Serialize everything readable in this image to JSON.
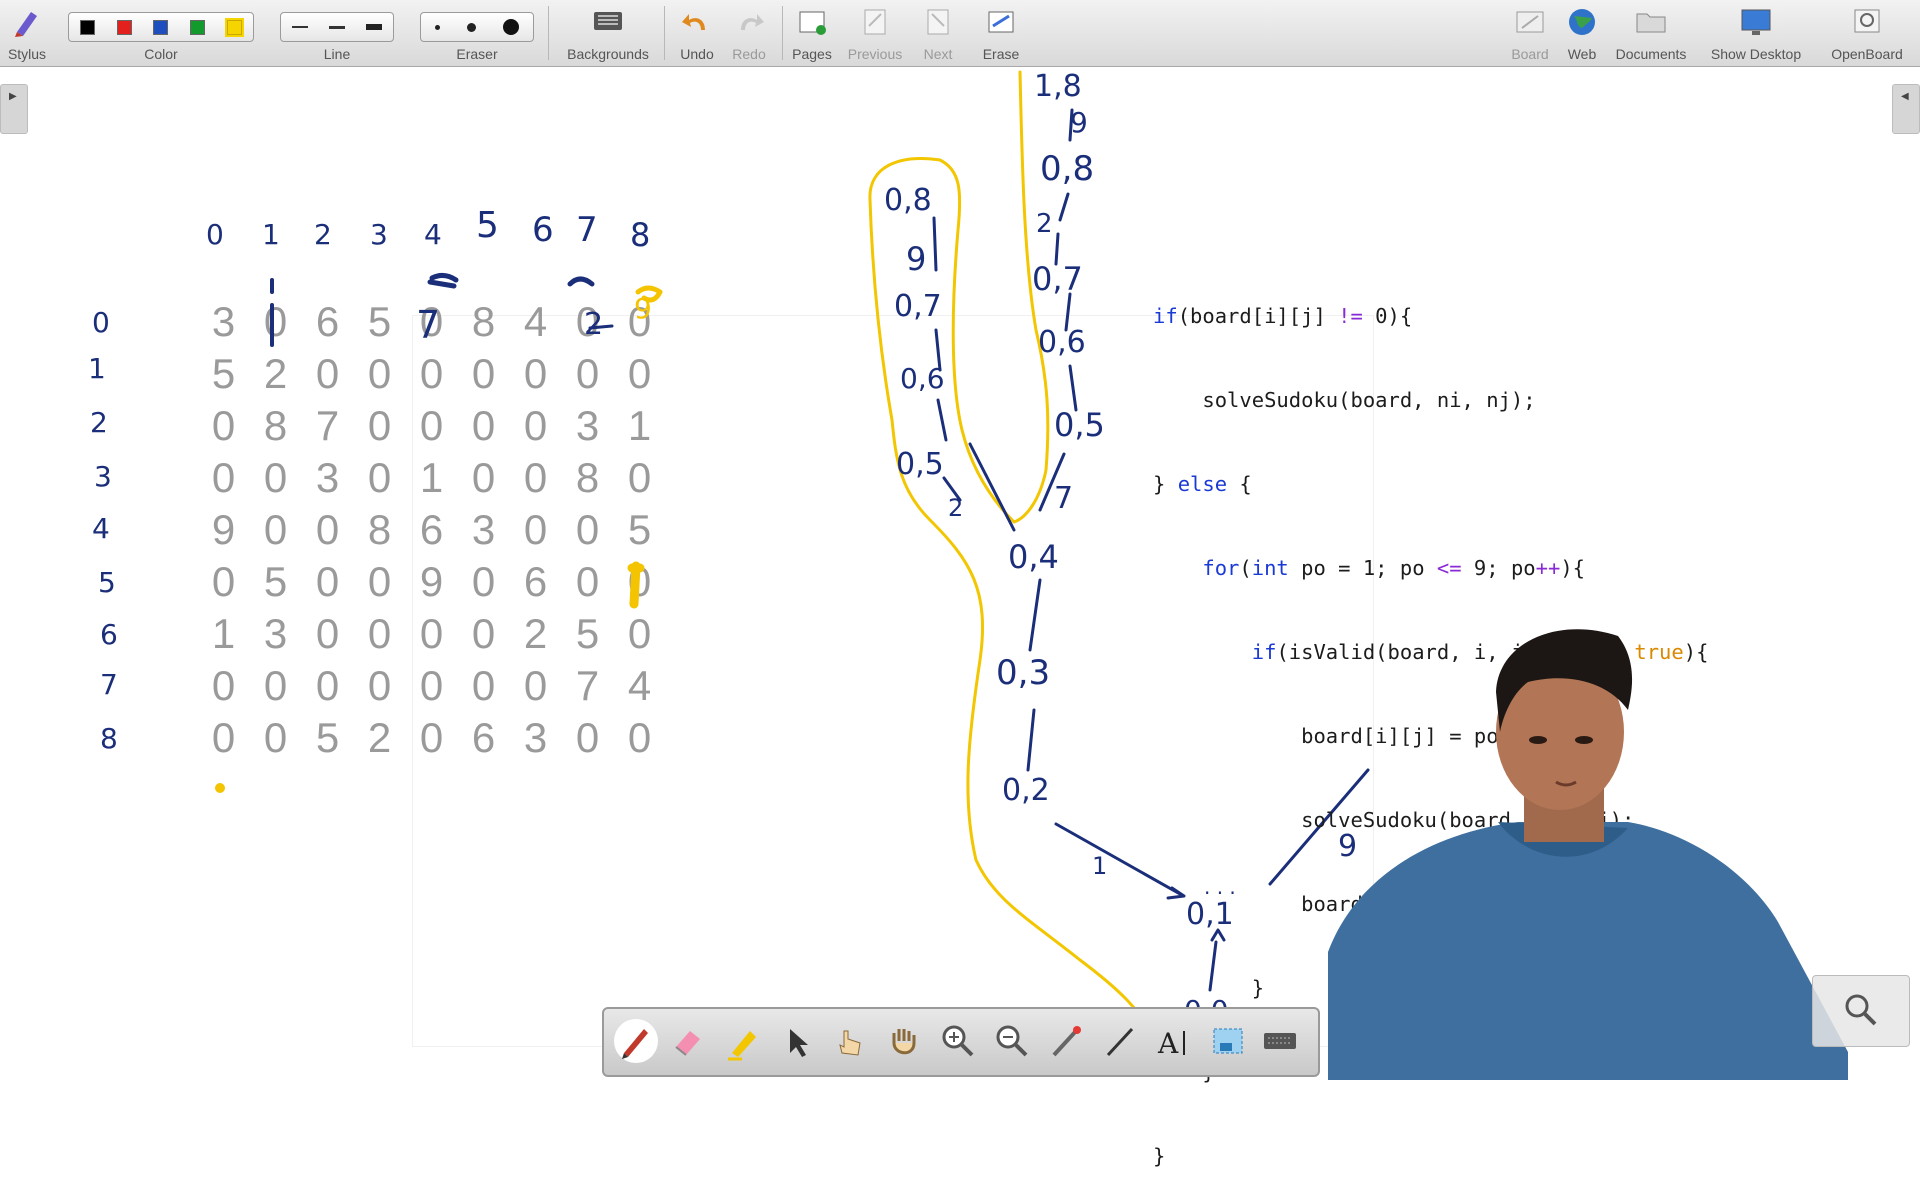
{
  "toolbar": {
    "stylus": "Stylus",
    "color": "Color",
    "line": "Line",
    "eraser": "Eraser",
    "backgrounds": "Backgrounds",
    "undo": "Undo",
    "redo": "Redo",
    "pages": "Pages",
    "previous": "Previous",
    "next": "Next",
    "erase": "Erase",
    "board": "Board",
    "web": "Web",
    "documents": "Documents",
    "show_desktop": "Show Desktop",
    "openboard": "OpenBoard",
    "colors": [
      "#000000",
      "#e3201b",
      "#1f4fbf",
      "#139a2c",
      "#f5d400"
    ]
  },
  "sudoku": {
    "col_headers": [
      "0",
      "1",
      "2",
      "3",
      "4",
      "5",
      "6",
      "7",
      "8"
    ],
    "row_headers": [
      "0",
      "1",
      "2",
      "3",
      "4",
      "5",
      "6",
      "7",
      "8"
    ],
    "rows": [
      [
        "3",
        "0",
        "6",
        "5",
        "0",
        "8",
        "4",
        "0",
        "0"
      ],
      [
        "5",
        "2",
        "0",
        "0",
        "0",
        "0",
        "0",
        "0",
        "0"
      ],
      [
        "0",
        "8",
        "7",
        "0",
        "0",
        "0",
        "0",
        "3",
        "1"
      ],
      [
        "0",
        "0",
        "3",
        "0",
        "1",
        "0",
        "0",
        "8",
        "0"
      ],
      [
        "9",
        "0",
        "0",
        "8",
        "6",
        "3",
        "0",
        "0",
        "5"
      ],
      [
        "0",
        "5",
        "0",
        "0",
        "9",
        "0",
        "6",
        "0",
        "0"
      ],
      [
        "1",
        "3",
        "0",
        "0",
        "0",
        "0",
        "2",
        "5",
        "0"
      ],
      [
        "0",
        "0",
        "0",
        "0",
        "0",
        "0",
        "0",
        "7",
        "4"
      ],
      [
        "0",
        "0",
        "5",
        "2",
        "0",
        "6",
        "3",
        "0",
        "0"
      ]
    ],
    "annotations": [
      "7",
      "2",
      "9"
    ]
  },
  "tree": {
    "nodes": [
      "1,8",
      "0,8",
      "0,7",
      "0,6",
      "0,5",
      "0,4",
      "0,3",
      "0,2",
      "0,1",
      "0,0",
      "0,8",
      "0,7",
      "0,6",
      "0,5"
    ],
    "edge_labels": [
      "9",
      "9",
      "2",
      "7",
      "2",
      "1",
      "9"
    ]
  },
  "code": {
    "lines": [
      "if(board[i][j] != 0){",
      "    solveSudoku(board, ni, nj);",
      "} else {",
      "    for(int po = 1; po <= 9; po++){",
      "        if(isValid(board, i, j, po) == true){",
      "            board[i][j] = po;",
      "            solveSudoku(board, ni, nj);",
      "            board[i][j] = 0;",
      "        }",
      "    }",
      "}"
    ]
  },
  "bottom_tools": [
    "pen-icon",
    "eraser-icon",
    "highlighter-icon",
    "pointer-icon",
    "hand-pointer-icon",
    "pan-hand-icon",
    "zoom-in-icon",
    "zoom-out-icon",
    "laser-icon",
    "line-icon",
    "text-icon",
    "capture-icon",
    "keyboard-icon"
  ]
}
